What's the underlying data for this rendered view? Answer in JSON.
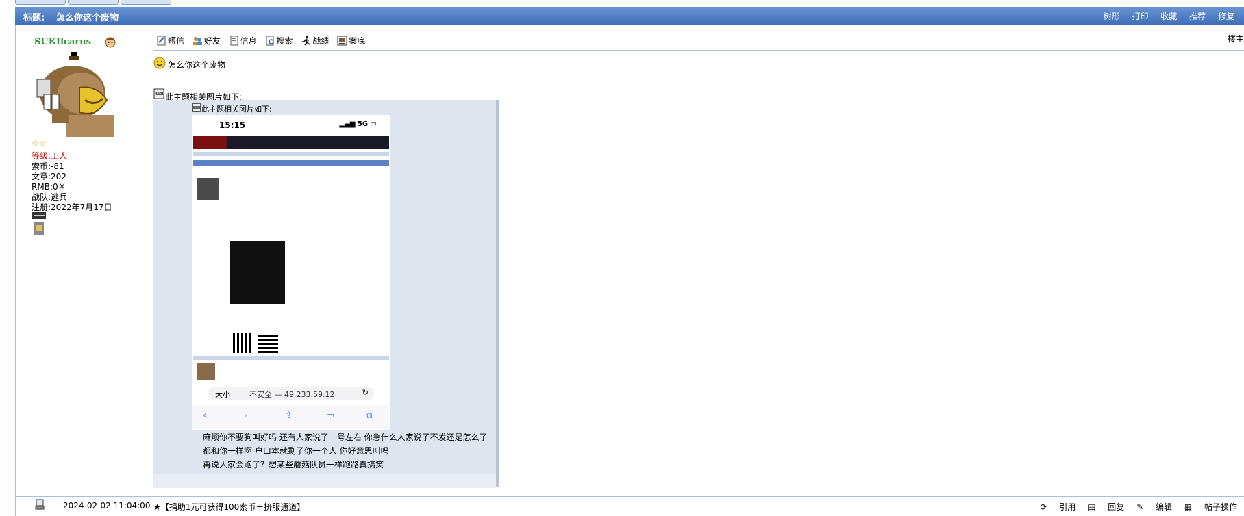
{
  "header": {
    "title_label": "标题:",
    "subject": "怎么你这个废物",
    "tools": [
      "树形",
      "打印",
      "收藏",
      "推荐",
      "修复"
    ]
  },
  "user": {
    "name": "SUKIlcarus",
    "stars": "☆☆",
    "level_label": "等级:",
    "level": "工人",
    "stats": [
      {
        "label": "索币:",
        "value": "-81"
      },
      {
        "label": "文章:",
        "value": "202"
      },
      {
        "label": "RMB:",
        "value": "0￥"
      },
      {
        "label": "战队:",
        "value": "逃兵"
      },
      {
        "label": "注册:",
        "value": "2022年7月17日"
      }
    ]
  },
  "toolbar": {
    "items": [
      "短信",
      "好友",
      "信息",
      "搜索",
      "战绩",
      "案底"
    ],
    "floor": "楼主"
  },
  "post": {
    "title": "怎么你这个废物",
    "image_caption": "此主题相关图片如下:",
    "inner_caption": "此主题相关图片如下:",
    "phone_time": "15:15",
    "phone_signal": "5G",
    "phone_url_label": "大小",
    "phone_url": "不安全 — 49.233.59.12",
    "chat_lines": [
      "麻烦你不要狗叫好吗 还有人家说了一号左右 你急什么人家说了不发还是怎么了",
      "都和你一样啊 户口本就剩了你一个人 你好意思叫吗",
      "再说人家会跑了？想某些蘑菇队员一样跑路真搞笑"
    ]
  },
  "footer": {
    "time": "2024-02-02 11:04:00",
    "promo": "★【捐助1元可获得100索币＋挤服通道】",
    "actions": [
      "引用",
      "回复",
      "编辑",
      "帖子操作"
    ]
  },
  "colors": {
    "title_bar": "#4a7bc4",
    "username": "#2e9a2e",
    "level": "#cc0000",
    "frame": "#a9bfe0"
  }
}
